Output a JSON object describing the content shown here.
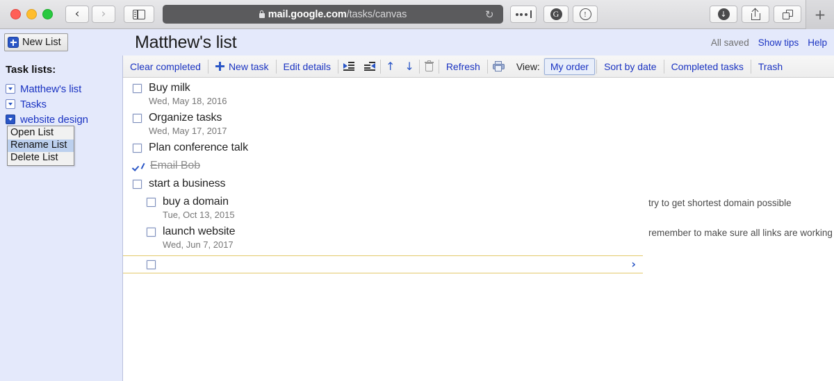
{
  "browser": {
    "url_domain": "mail.google.com",
    "url_path": "/tasks/canvas",
    "back_label": "‹",
    "forward_label": "›",
    "reload_label": "↻",
    "new_tab_label": "+",
    "download_label": "↓",
    "grammarly_label": "G",
    "password_label": "!"
  },
  "header": {
    "new_list_label": "New List",
    "title": "Matthew's list",
    "saved_status": "All saved",
    "show_tips_label": "Show tips",
    "help_label": "Help"
  },
  "sidebar": {
    "title": "Task lists:",
    "lists": [
      {
        "label": "Matthew's list",
        "active": false
      },
      {
        "label": "Tasks",
        "active": false
      },
      {
        "label": "website design",
        "active": true
      }
    ],
    "context_menu": {
      "items": [
        {
          "label": "Open List",
          "selected": false
        },
        {
          "label": "Rename List",
          "selected": true
        },
        {
          "label": "Delete List",
          "selected": false
        }
      ]
    }
  },
  "toolbar": {
    "clear_completed": "Clear completed",
    "new_task": "New task",
    "edit_details": "Edit details",
    "indent_icon": "indent",
    "outdent_icon": "outdent",
    "move_up": "↑",
    "move_down": "↓",
    "delete_icon": "trash",
    "refresh": "Refresh",
    "print_icon": "print",
    "view_label": "View:",
    "my_order": "My order",
    "sort_by_date": "Sort by date",
    "completed_tasks": "Completed tasks",
    "trash": "Trash",
    "selected_view": "My order"
  },
  "tasks": [
    {
      "title": "Buy milk",
      "date": "Wed, May 18, 2016",
      "done": false,
      "sub": false,
      "note": ""
    },
    {
      "title": "Organize tasks",
      "date": "Wed, May 17, 2017",
      "done": false,
      "sub": false,
      "note": ""
    },
    {
      "title": "Plan conference talk",
      "date": "",
      "done": false,
      "sub": false,
      "note": ""
    },
    {
      "title": "Email Bob",
      "date": "",
      "done": true,
      "sub": false,
      "note": ""
    },
    {
      "title": "start a business",
      "date": "",
      "done": false,
      "sub": false,
      "note": ""
    },
    {
      "title": "buy a domain",
      "date": "Tue, Oct 13, 2015",
      "done": false,
      "sub": true,
      "note": "try to get shortest domain possible"
    },
    {
      "title": "launch website",
      "date": "Wed, Jun 7, 2017",
      "done": false,
      "sub": true,
      "note": "remember to make sure all links are working"
    }
  ],
  "new_task_row": {
    "value": "",
    "chevron": "›"
  },
  "colors": {
    "accent_blue": "#2a56c6",
    "link_blue": "#1a33c2",
    "header_bg": "#e4e9fb",
    "new_row_border": "#e3c96a",
    "selected_menu_bg": "#bcd0ee"
  }
}
